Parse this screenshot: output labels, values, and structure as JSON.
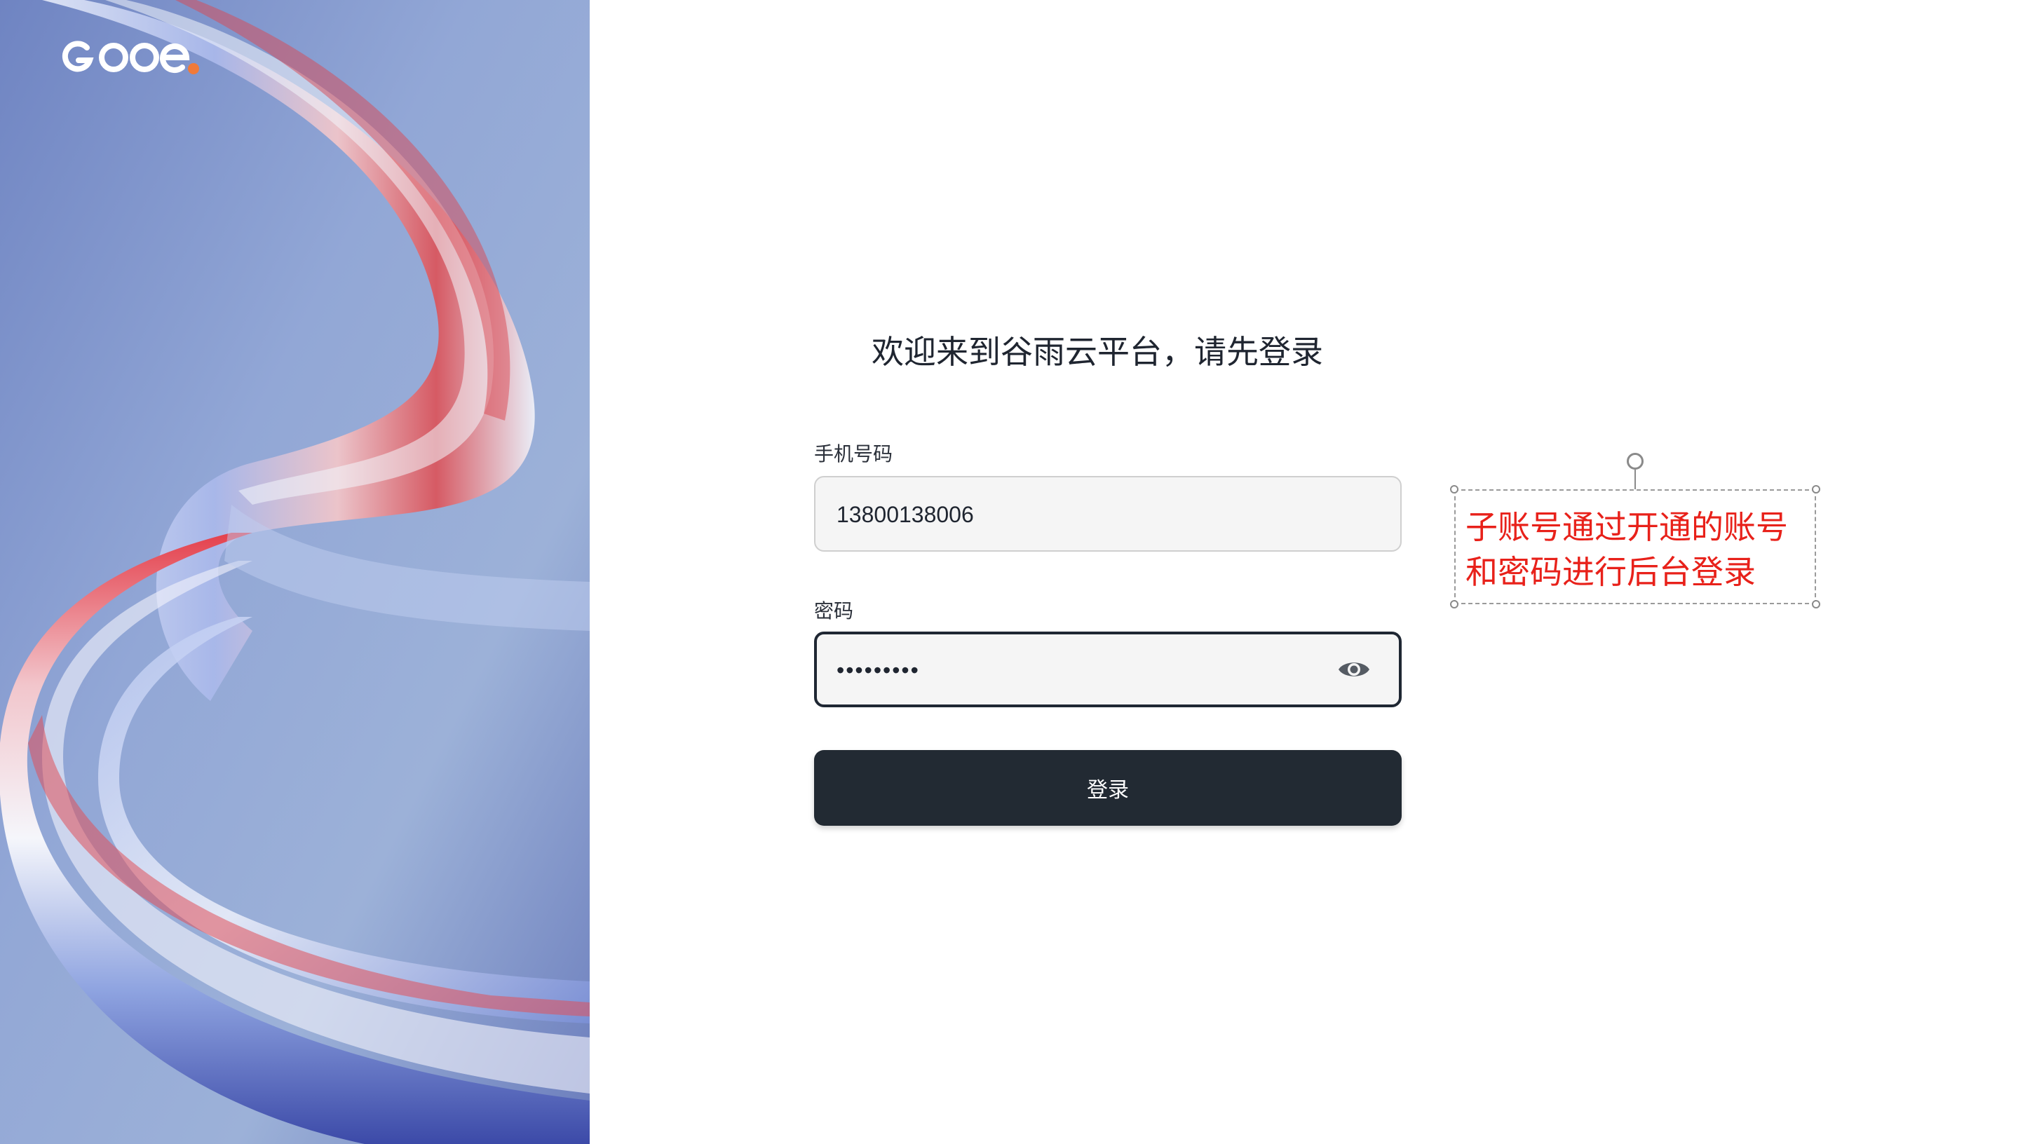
{
  "brand": {
    "logo_text": "GOOe"
  },
  "login": {
    "welcome": "欢迎来到谷雨云平台，请先登录",
    "phone_label": "手机号码",
    "phone_value": "13800138006",
    "password_label": "密码",
    "password_value": "•••••••••",
    "submit_label": "登录"
  },
  "annotation": {
    "line1": "子账号通过开通的账号",
    "line2": "和密码进行后台登录"
  },
  "colors": {
    "accent_dark": "#222a33",
    "annotation_red": "#e8211a",
    "logo_badge": "#f07a3a"
  },
  "icons": {
    "password_toggle": "eye-icon"
  }
}
